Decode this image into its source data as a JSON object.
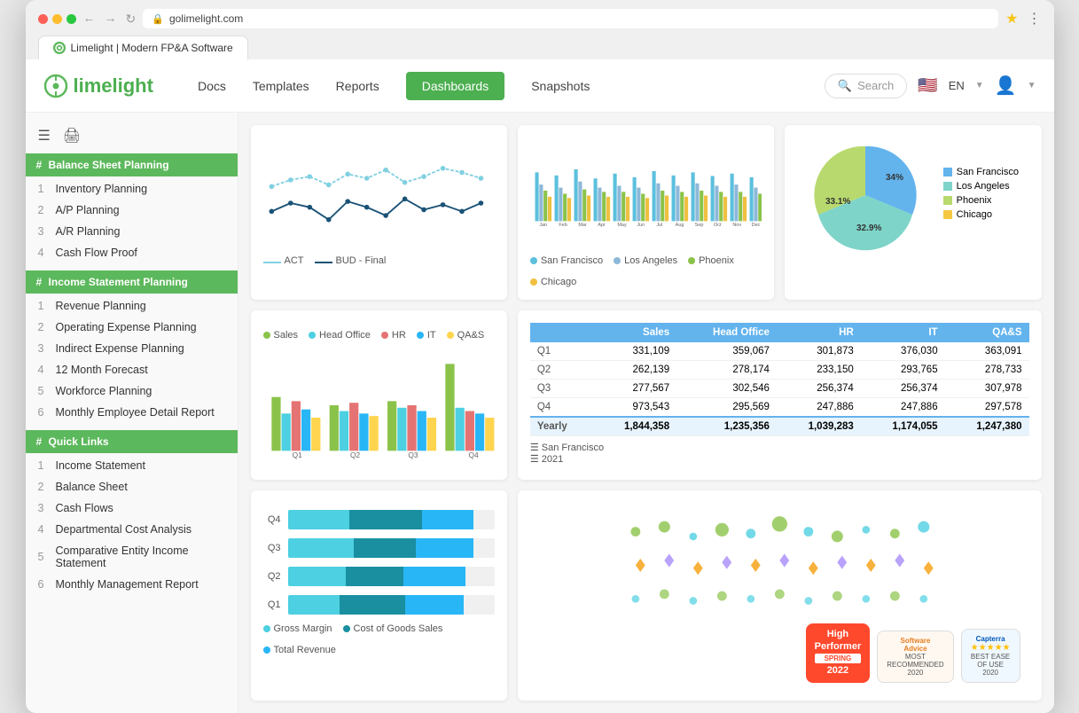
{
  "browser": {
    "url": "golimelight.com",
    "tab_title": "Limelight | Modern FP&A Software",
    "favicon_color": "#5cb85c"
  },
  "nav": {
    "logo_text": "limelight",
    "docs_label": "Docs",
    "templates_label": "Templates",
    "reports_label": "Reports",
    "dashboards_label": "Dashboards",
    "snapshots_label": "Snapshots",
    "search_placeholder": "Search",
    "lang": "EN",
    "colors": {
      "accent": "#5cb85c",
      "active_bg": "#4caf50"
    }
  },
  "sidebar": {
    "section1_title": "Balance Sheet Planning",
    "section1_items": [
      {
        "num": 1,
        "label": "Inventory Planning"
      },
      {
        "num": 2,
        "label": "A/P Planning"
      },
      {
        "num": 3,
        "label": "A/R Planning"
      },
      {
        "num": 4,
        "label": "Cash Flow Proof"
      }
    ],
    "section2_title": "Income Statement Planning",
    "section2_items": [
      {
        "num": 1,
        "label": "Revenue Planning"
      },
      {
        "num": 2,
        "label": "Operating Expense Planning"
      },
      {
        "num": 3,
        "label": "Indirect Expense Planning"
      },
      {
        "num": 4,
        "label": "12 Month Forecast"
      },
      {
        "num": 5,
        "label": "Workforce Planning"
      },
      {
        "num": 6,
        "label": "Monthly Employee Detail Report"
      }
    ],
    "section3_title": "Quick Links",
    "section3_items": [
      {
        "num": 1,
        "label": "Income Statement"
      },
      {
        "num": 2,
        "label": "Balance Sheet"
      },
      {
        "num": 3,
        "label": "Cash Flows"
      },
      {
        "num": 4,
        "label": "Departmental Cost Analysis"
      },
      {
        "num": 5,
        "label": "Comparative Entity Income Statement"
      },
      {
        "num": 6,
        "label": "Monthly Management Report"
      }
    ]
  },
  "charts": {
    "line": {
      "legend": [
        "ACT",
        "BUD - Final"
      ],
      "colors": [
        "#80d0e0",
        "#1a5276"
      ]
    },
    "bar": {
      "months": [
        "Jan",
        "Feb",
        "Mar",
        "Apr",
        "May",
        "Jun",
        "Jul",
        "Aug",
        "Sep",
        "Oct",
        "Nov",
        "Dec"
      ],
      "legend": [
        "San Francisco",
        "Los Angeles",
        "Phoenix",
        "Chicago"
      ],
      "colors": [
        "#5bc0de",
        "#8db8d8",
        "#8bc34a",
        "#f0c040"
      ]
    },
    "pie": {
      "segments": [
        {
          "label": "San Francisco",
          "value": 34,
          "color": "#63b3ed"
        },
        {
          "label": "Los Angeles",
          "value": 33.1,
          "color": "#7ed4c8"
        },
        {
          "label": "Phoenix",
          "value": 32.9,
          "color": "#b8d96e"
        },
        {
          "label": "Chicago",
          "color": "#f5c842"
        }
      ],
      "labels": [
        "33.1%",
        "34%",
        "32.9%"
      ]
    },
    "grouped": {
      "quarters": [
        "Q1",
        "Q2",
        "Q3",
        "Q4"
      ],
      "legend": [
        "Sales",
        "Head Office",
        "HR",
        "IT",
        "QA&S"
      ],
      "colors": [
        "#8bc34a",
        "#4dd0e1",
        "#e57373",
        "#29b6f6",
        "#ffd54f"
      ]
    },
    "table": {
      "headers": [
        "",
        "Sales",
        "Head Office",
        "HR",
        "IT",
        "QA&S"
      ],
      "rows": [
        {
          "label": "Q1",
          "sales": "331,109",
          "headoffice": "359,067",
          "hr": "301,873",
          "it": "376,030",
          "qas": "363,091"
        },
        {
          "label": "Q2",
          "sales": "262,139",
          "headoffice": "278,174",
          "hr": "233,150",
          "it": "293,765",
          "qas": "278,733"
        },
        {
          "label": "Q3",
          "sales": "277,567",
          "headoffice": "302,546",
          "hr": "256,374",
          "it": "256,374",
          "qas": "307,978"
        },
        {
          "label": "Q4",
          "sales": "973,543",
          "headoffice": "295,569",
          "hr": "247,886",
          "it": "247,886",
          "qas": "297,578"
        }
      ],
      "yearly": {
        "label": "Yearly",
        "sales": "1,844,358",
        "headoffice": "1,235,356",
        "hr": "1,039,283",
        "it": "1,174,055",
        "qas": "1,247,380"
      },
      "footer1": "San Francisco",
      "footer2": "2021"
    },
    "horizontal": {
      "quarters": [
        "Q4",
        "Q3",
        "Q2",
        "Q1"
      ],
      "legend": [
        "Gross Margin",
        "Cost of Goods Sales",
        "Total Revenue"
      ],
      "colors": [
        "#4dd0e1",
        "#1a8fa0",
        "#29b6f6"
      ]
    },
    "scatter": {
      "colors": [
        "#8bc34a",
        "#4dd0e1",
        "#f59e0b",
        "#a78bfa"
      ]
    }
  },
  "badges": [
    {
      "type": "g2",
      "line1": "High",
      "line2": "Performer",
      "line3": "SPRING",
      "line4": "2022"
    },
    {
      "type": "software",
      "line1": "Software",
      "line2": "Advice",
      "line3": "MOST",
      "line4": "RECOMMENDED",
      "line5": "2020"
    },
    {
      "type": "capterra",
      "line1": "Capterra",
      "line2": "BEST EASE",
      "line3": "OF USE",
      "line4": "2020"
    }
  ]
}
